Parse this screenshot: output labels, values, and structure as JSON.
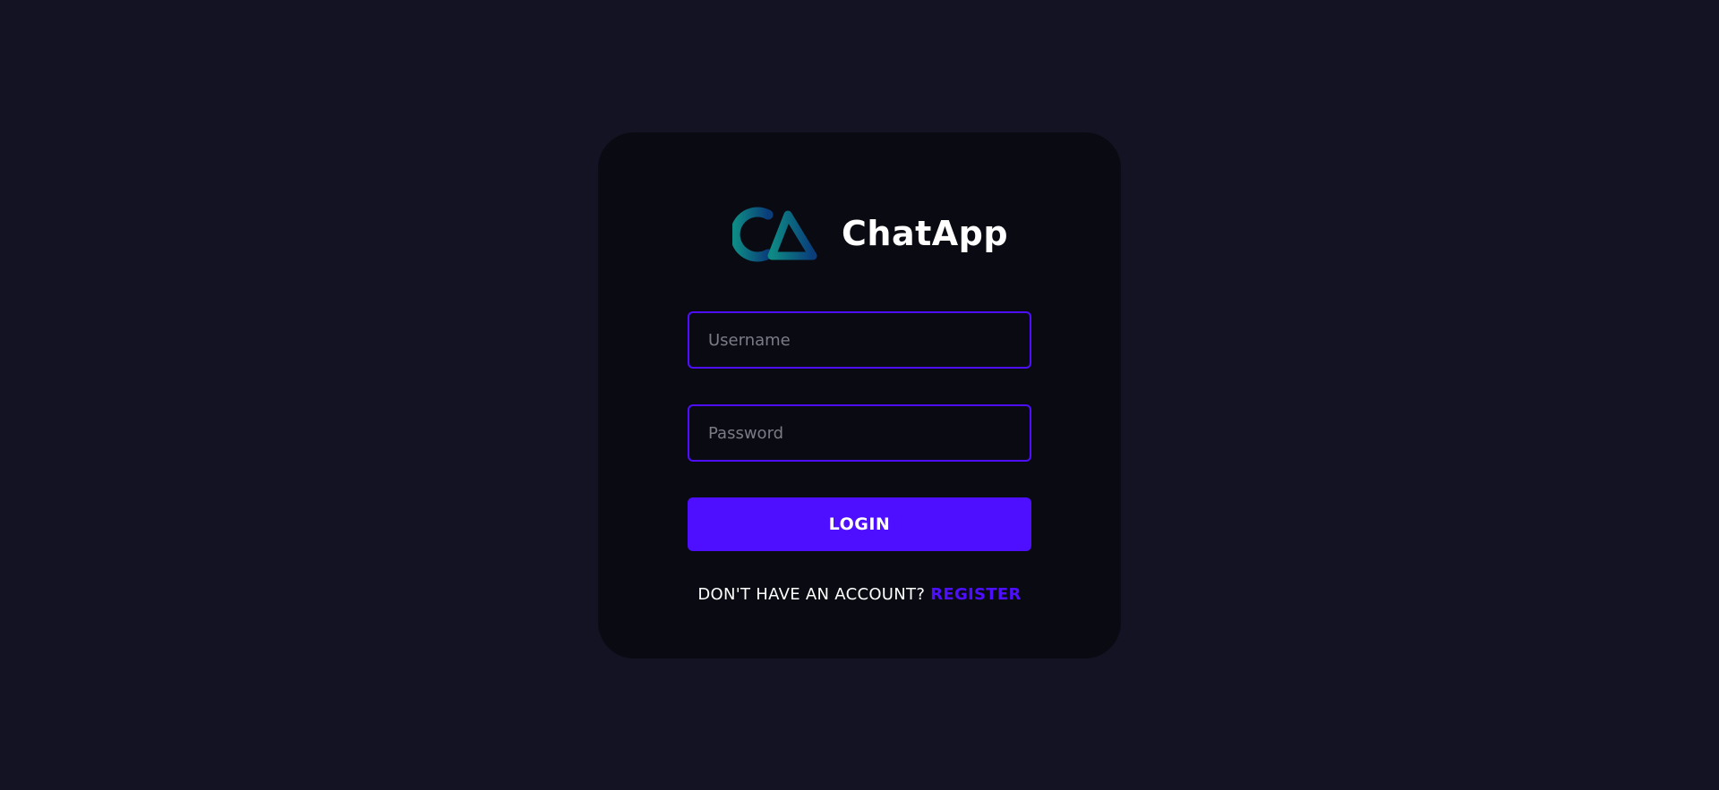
{
  "brand": {
    "name": "ChatApp",
    "logo_icon": "chatapp-logo-icon",
    "logo_colors": [
      "#0e8a84",
      "#0a3d7a"
    ]
  },
  "form": {
    "username_placeholder": "Username",
    "username_value": "",
    "password_placeholder": "Password",
    "password_value": "",
    "login_label": "LOGIN"
  },
  "register": {
    "prompt": "DON'T HAVE AN ACCOUNT?",
    "link_label": "REGISTER"
  },
  "colors": {
    "page_background": "#131324",
    "card_background": "#0a0b12",
    "accent": "#4e0eff",
    "text": "#ffffff",
    "placeholder": "#7b7b86"
  }
}
